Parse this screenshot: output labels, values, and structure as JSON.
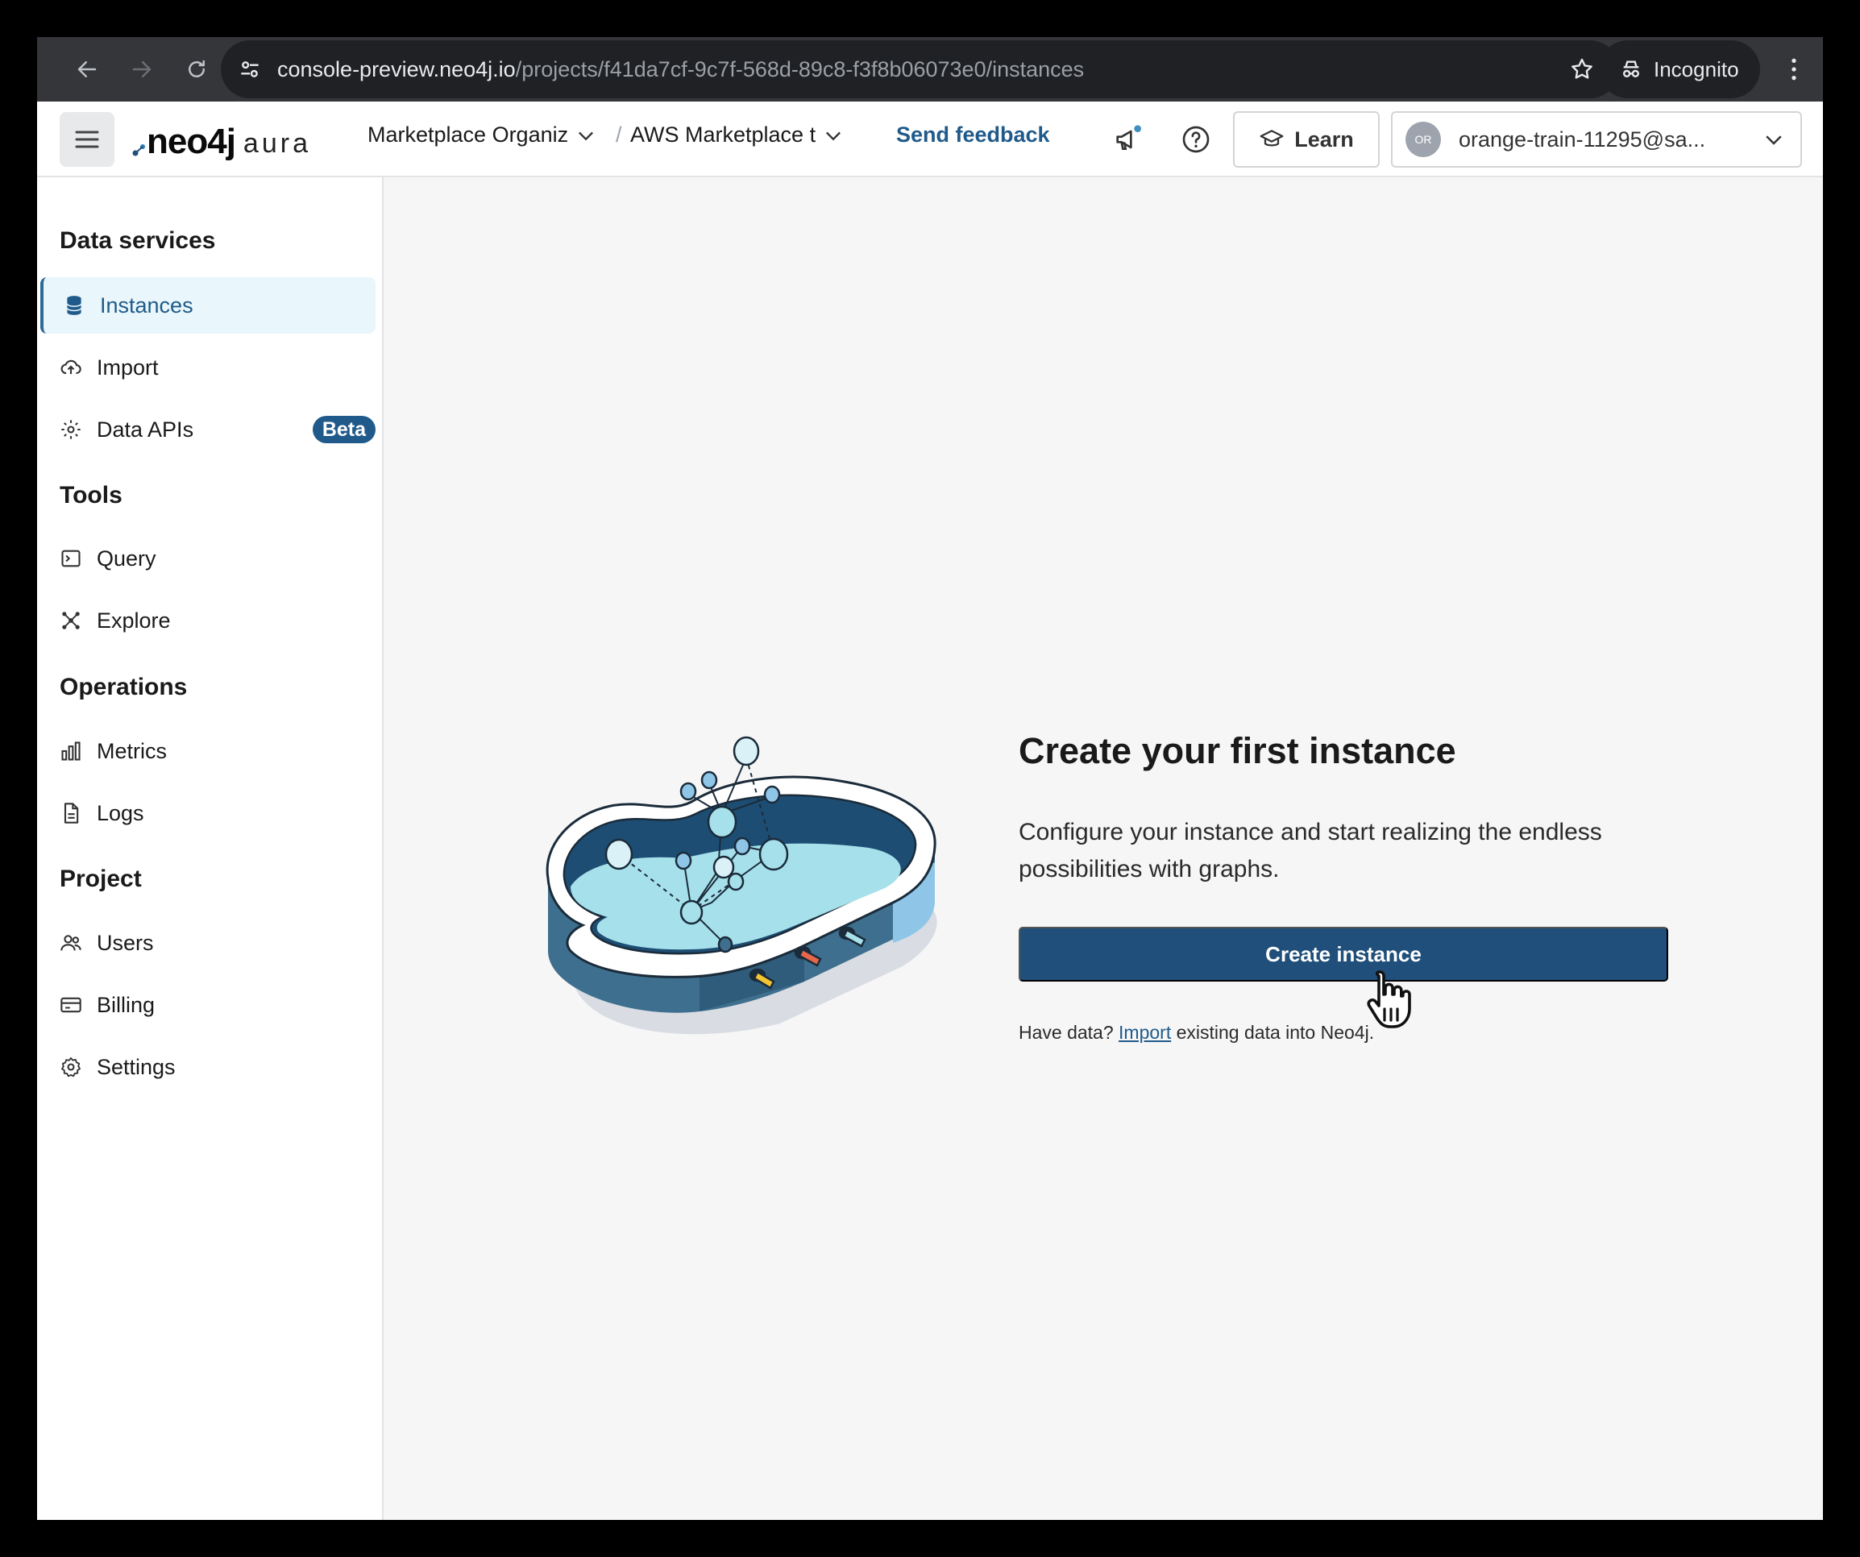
{
  "browser": {
    "url_host": "console-preview.neo4j.io",
    "url_path": "/projects/f41da7cf-9c7f-568d-89c8-f3f8b06073e0/instances",
    "incognito_label": "Incognito"
  },
  "topbar": {
    "logo_neo": "neo4j",
    "logo_aura": "aura",
    "organization": "Marketplace Organiz",
    "project": "AWS Marketplace t",
    "breadcrumb_separator": "/",
    "feedback_label": "Send feedback",
    "learn_label": "Learn",
    "avatar_initials": "OR",
    "user_email": "orange-train-11295@sa..."
  },
  "sidebar": {
    "sections": [
      {
        "title": "Data services",
        "items": [
          {
            "label": "Instances",
            "icon": "database-icon",
            "active": true
          },
          {
            "label": "Import",
            "icon": "cloud-upload-icon"
          },
          {
            "label": "Data APIs",
            "icon": "data-api-icon",
            "badge": "Beta"
          }
        ]
      },
      {
        "title": "Tools",
        "items": [
          {
            "label": "Query",
            "icon": "terminal-icon"
          },
          {
            "label": "Explore",
            "icon": "graph-explore-icon"
          }
        ]
      },
      {
        "title": "Operations",
        "items": [
          {
            "label": "Metrics",
            "icon": "bar-chart-icon"
          },
          {
            "label": "Logs",
            "icon": "document-icon"
          }
        ]
      },
      {
        "title": "Project",
        "items": [
          {
            "label": "Users",
            "icon": "users-icon"
          },
          {
            "label": "Billing",
            "icon": "credit-card-icon"
          },
          {
            "label": "Settings",
            "icon": "gear-icon"
          }
        ]
      }
    ]
  },
  "main": {
    "title": "Create your first instance",
    "description": "Configure your instance and start realizing the endless possibilities with graphs.",
    "create_button": "Create instance",
    "helper_prefix": "Have data?",
    "helper_link": "Import",
    "helper_suffix": "existing data into Neo4j."
  },
  "colors": {
    "primary": "#1f4f7a",
    "link": "#1f5a8a",
    "active_bg": "#e9f6fb",
    "page_bg": "#f6f6f7"
  }
}
